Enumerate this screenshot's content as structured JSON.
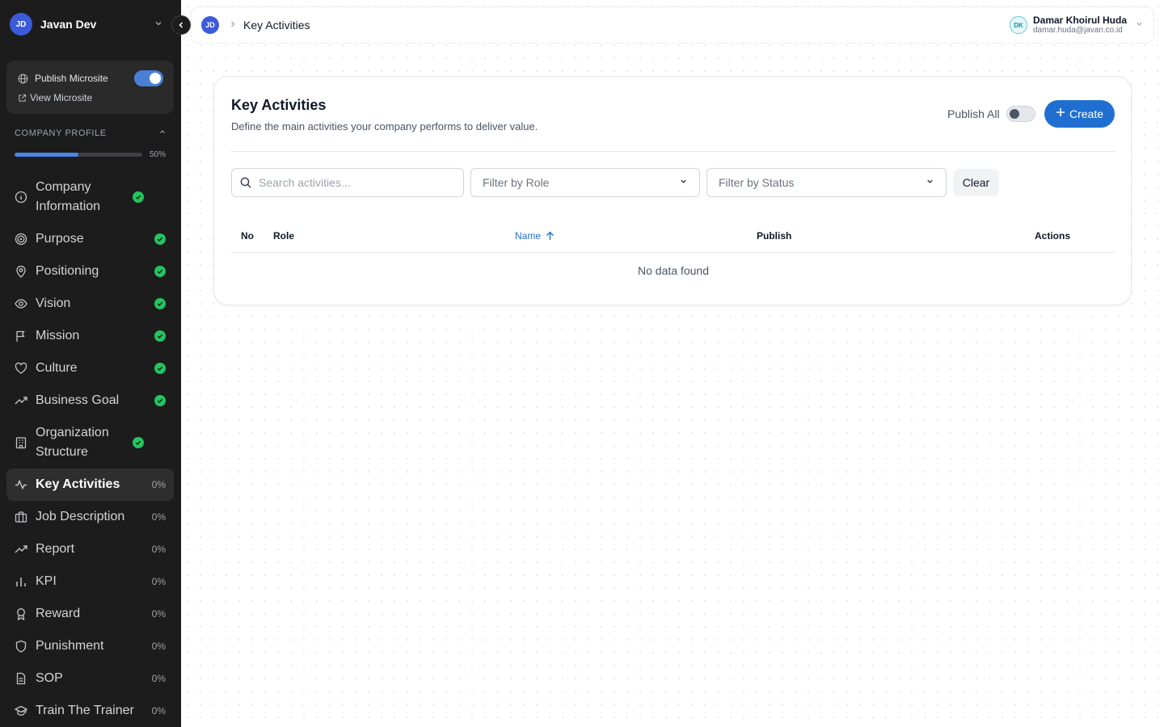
{
  "workspace": {
    "initials": "JD",
    "name": "Javan Dev"
  },
  "microsite": {
    "publish_label": "Publish Microsite",
    "publish_enabled": true,
    "view_label": "View Microsite"
  },
  "company_profile": {
    "title": "COMPANY PROFILE",
    "progress": 50,
    "progress_label": "50%"
  },
  "nav": [
    {
      "label": "Company Information",
      "status": "done",
      "icon": "info-icon"
    },
    {
      "label": "Purpose",
      "status": "done",
      "icon": "target-icon"
    },
    {
      "label": "Positioning",
      "status": "done",
      "icon": "map-pin-icon"
    },
    {
      "label": "Vision",
      "status": "done",
      "icon": "eye-icon"
    },
    {
      "label": "Mission",
      "status": "done",
      "icon": "flag-icon"
    },
    {
      "label": "Culture",
      "status": "done",
      "icon": "heart-icon"
    },
    {
      "label": "Business Goal",
      "status": "done",
      "icon": "trending-up-icon"
    },
    {
      "label": "Organization Structure",
      "status": "done",
      "icon": "building-icon"
    },
    {
      "label": "Key Activities",
      "status": "0%",
      "icon": "activity-icon",
      "active": true
    },
    {
      "label": "Job Description",
      "status": "0%",
      "icon": "briefcase-icon"
    },
    {
      "label": "Report",
      "status": "0%",
      "icon": "trending-up-icon"
    },
    {
      "label": "KPI",
      "status": "0%",
      "icon": "bar-chart-icon"
    },
    {
      "label": "Reward",
      "status": "0%",
      "icon": "award-icon"
    },
    {
      "label": "Punishment",
      "status": "0%",
      "icon": "shield-icon"
    },
    {
      "label": "SOP",
      "status": "0%",
      "icon": "document-icon"
    },
    {
      "label": "Train The Trainer",
      "status": "0%",
      "icon": "graduation-cap-icon"
    }
  ],
  "topbar": {
    "avatar_initials": "JD",
    "breadcrumb": "Key Activities",
    "user": {
      "initials": "DK",
      "name": "Damar Khoirul Huda",
      "email": "damar.huda@javan.co.id"
    }
  },
  "page": {
    "title": "Key Activities",
    "description": "Define the main activities your company performs to deliver value.",
    "publish_all_label": "Publish All",
    "publish_all_enabled": false,
    "create_label": "Create",
    "search_placeholder": "Search activities...",
    "filter_role": "Filter by Role",
    "filter_status": "Filter by Status",
    "clear_label": "Clear",
    "columns": {
      "no": "No",
      "role": "Role",
      "name": "Name",
      "publish": "Publish",
      "actions": "Actions"
    },
    "sort_direction": "ascending",
    "empty_text": "No data found"
  },
  "colors": {
    "accent": "#1f6fd1",
    "sidebar_bg": "#1c1c1c",
    "success": "#22c55e",
    "toggle_on": "#4a7fd6"
  }
}
